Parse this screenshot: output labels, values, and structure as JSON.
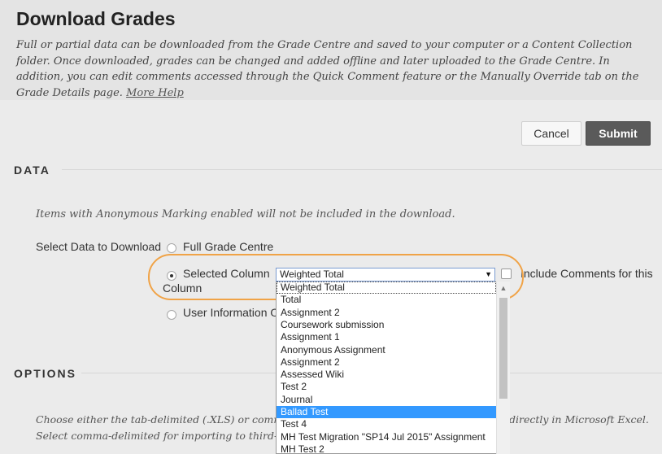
{
  "header": {
    "title": "Download Grades",
    "intro": "Full or partial data can be downloaded from the Grade Centre and saved to your computer or a Content Collection folder. Once downloaded, grades can be changed and added offline and later uploaded to the Grade Centre. In addition, you can edit comments accessed through the Quick Comment feature or the Manually Override tab on the Grade Details page.",
    "help_link": "More Help"
  },
  "actions": {
    "cancel_label": "Cancel",
    "submit_label": "Submit"
  },
  "data_section": {
    "title": "DATA",
    "note": "Items with Anonymous Marking enabled will not be included in the download.",
    "select_label": "Select Data to Download",
    "options": [
      {
        "label": "Full Grade Centre",
        "checked": false
      },
      {
        "label": "Selected Column",
        "checked": true
      },
      {
        "label": "User Information On",
        "checked": false
      }
    ],
    "column_wrap": "Column",
    "selected_column": "Weighted Total",
    "include_comments_label": "Include Comments for this",
    "dropdown_items": [
      "Weighted Total",
      "Total",
      "Assignment 2",
      "Coursework submission",
      "Assignment 1",
      "Anonymous Assignment",
      "Assignment 2",
      "Assessed Wiki",
      "Test 2",
      "Journal",
      "Ballad Test",
      "Test 4",
      "MH Test Migration \"SP14 Jul 2015\" Assignment",
      "MH Test 2"
    ],
    "highlighted_item": "Ballad Test"
  },
  "options_section": {
    "title": "OPTIONS",
    "text_left_1": "Choose either the tab-delimited (.XLS) or comma",
    "text_right_1": "directly in Microsoft Excel.",
    "text_left_2": "Select comma-delimited for importing to third-pa"
  },
  "colors": {
    "accent_ring": "#f0a347",
    "submit_bg": "#5a5a5a",
    "selection": "#3399ff"
  }
}
